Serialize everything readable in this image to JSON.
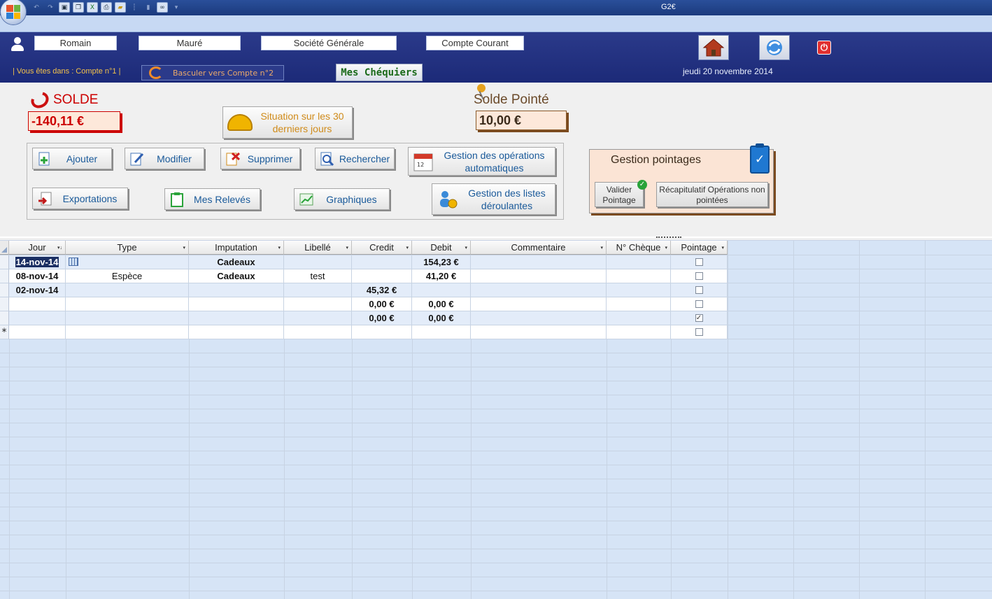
{
  "app": {
    "title": "G2€",
    "quick_access_icons": [
      "undo-icon",
      "redo-icon",
      "save-icon",
      "copy-icon",
      "excel-icon",
      "print-icon",
      "folder-icon",
      "separator",
      "binoculars-icon",
      "customize-icon"
    ]
  },
  "header": {
    "first_name": "Romain",
    "last_name": "Mauré",
    "bank": "Société Générale",
    "account": "Compte Courant",
    "location_text": "| Vous êtes dans : Compte n°1 |",
    "switch_label": "Basculer vers Compte n°2",
    "tab_label": "Mes Chéquiers",
    "date": "jeudi 20 novembre 2014"
  },
  "solde": {
    "title": "SOLDE",
    "value": "-140,11 €",
    "pointe_title": "Solde Pointé",
    "pointe_value": "10,00 €"
  },
  "buttons": {
    "situation": "Situation sur les 30 derniers jours",
    "ajouter": "Ajouter",
    "modifier": "Modifier",
    "supprimer": "Supprimer",
    "rechercher": "Rechercher",
    "gestion_auto": "Gestion des opérations automatiques",
    "exportations": "Exportations",
    "releves": "Mes Relevés",
    "graphiques": "Graphiques",
    "listes": "Gestion des listes déroulantes"
  },
  "pointages": {
    "title": "Gestion pointages",
    "valider": "Valider Pointage",
    "recap": "Récapitulatif Opérations non pointées"
  },
  "table": {
    "columns": [
      "Jour",
      "Type",
      "Imputation",
      "Libellé",
      "Credit",
      "Debit",
      "Commentaire",
      "N° Chèque",
      "Pointage"
    ],
    "rows": [
      {
        "jour": "14-nov-14",
        "type": "",
        "imputation": "Cadeaux",
        "libelle": "",
        "credit": "",
        "debit": "154,23 €",
        "commentaire": "",
        "cheque": "",
        "pointage": false
      },
      {
        "jour": "08-nov-14",
        "type": "Espèce",
        "imputation": "Cadeaux",
        "libelle": "test",
        "credit": "",
        "debit": "41,20 €",
        "commentaire": "",
        "cheque": "",
        "pointage": false
      },
      {
        "jour": "02-nov-14",
        "type": "",
        "imputation": "",
        "libelle": "",
        "credit": "45,32 €",
        "debit": "",
        "commentaire": "",
        "cheque": "",
        "pointage": false
      },
      {
        "jour": "",
        "type": "",
        "imputation": "",
        "libelle": "",
        "credit": "0,00 €",
        "debit": "0,00 €",
        "commentaire": "",
        "cheque": "",
        "pointage": false
      },
      {
        "jour": "",
        "type": "",
        "imputation": "",
        "libelle": "",
        "credit": "0,00 €",
        "debit": "0,00 €",
        "commentaire": "",
        "cheque": "",
        "pointage": true
      }
    ],
    "new_row_marker": "*"
  },
  "colors": {
    "header_bg": "#1c2a78",
    "accent_red": "#cc0000",
    "button_text": "#1a5a9a",
    "grid_bg": "#d6e4f6"
  }
}
